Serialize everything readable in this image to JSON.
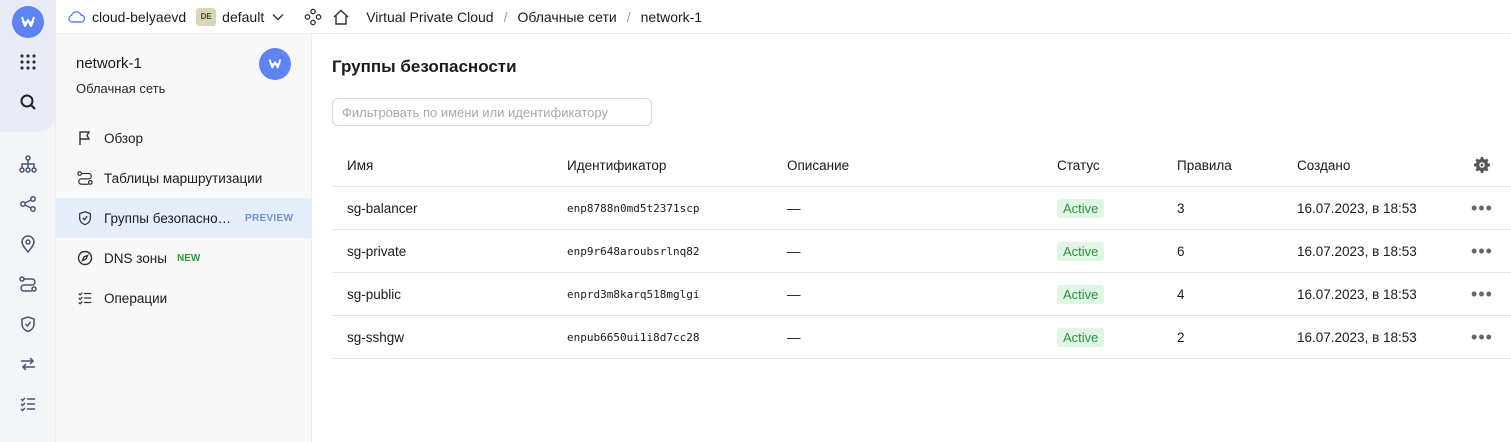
{
  "topbar": {
    "cloud_name": "cloud-belyaevd",
    "folder_badge": "DE",
    "folder_name": "default",
    "breadcrumbs": [
      "Virtual Private Cloud",
      "Облачные сети",
      "network-1"
    ]
  },
  "sidebar": {
    "title": "network-1",
    "subtitle": "Облачная сеть",
    "items": [
      {
        "label": "Обзор",
        "icon": "flag-icon"
      },
      {
        "label": "Таблицы маршрутизации",
        "icon": "route-icon"
      },
      {
        "label": "Группы безопасности",
        "icon": "shield-icon",
        "tag": "PREVIEW",
        "active": true
      },
      {
        "label": "DNS зоны",
        "icon": "compass-icon",
        "tag": "NEW"
      },
      {
        "label": "Операции",
        "icon": "list-check-icon"
      }
    ]
  },
  "main": {
    "title": "Группы безопасности",
    "filter_placeholder": "Фильтровать по имени или идентификатору",
    "columns": [
      "Имя",
      "Идентификатор",
      "Описание",
      "Статус",
      "Правила",
      "Создано"
    ],
    "rows": [
      {
        "name": "sg-balancer",
        "id": "enp8788n0md5t2371scp",
        "description": "—",
        "status": "Active",
        "rules": "3",
        "created": "16.07.2023, в 18:53"
      },
      {
        "name": "sg-private",
        "id": "enp9r648aroubsrlnq82",
        "description": "—",
        "status": "Active",
        "rules": "6",
        "created": "16.07.2023, в 18:53"
      },
      {
        "name": "sg-public",
        "id": "enprd3m8karq518mglgi",
        "description": "—",
        "status": "Active",
        "rules": "4",
        "created": "16.07.2023, в 18:53"
      },
      {
        "name": "sg-sshgw",
        "id": "enpub6650ui1i8d7cc28",
        "description": "—",
        "status": "Active",
        "rules": "2",
        "created": "16.07.2023, в 18:53"
      }
    ]
  },
  "colors": {
    "accent": "#5f84f2",
    "status_active_bg": "#e1f5e4",
    "status_active_text": "#2e8f40",
    "preview_tag": "#6f8fd6",
    "new_tag": "#2e9b3f"
  }
}
